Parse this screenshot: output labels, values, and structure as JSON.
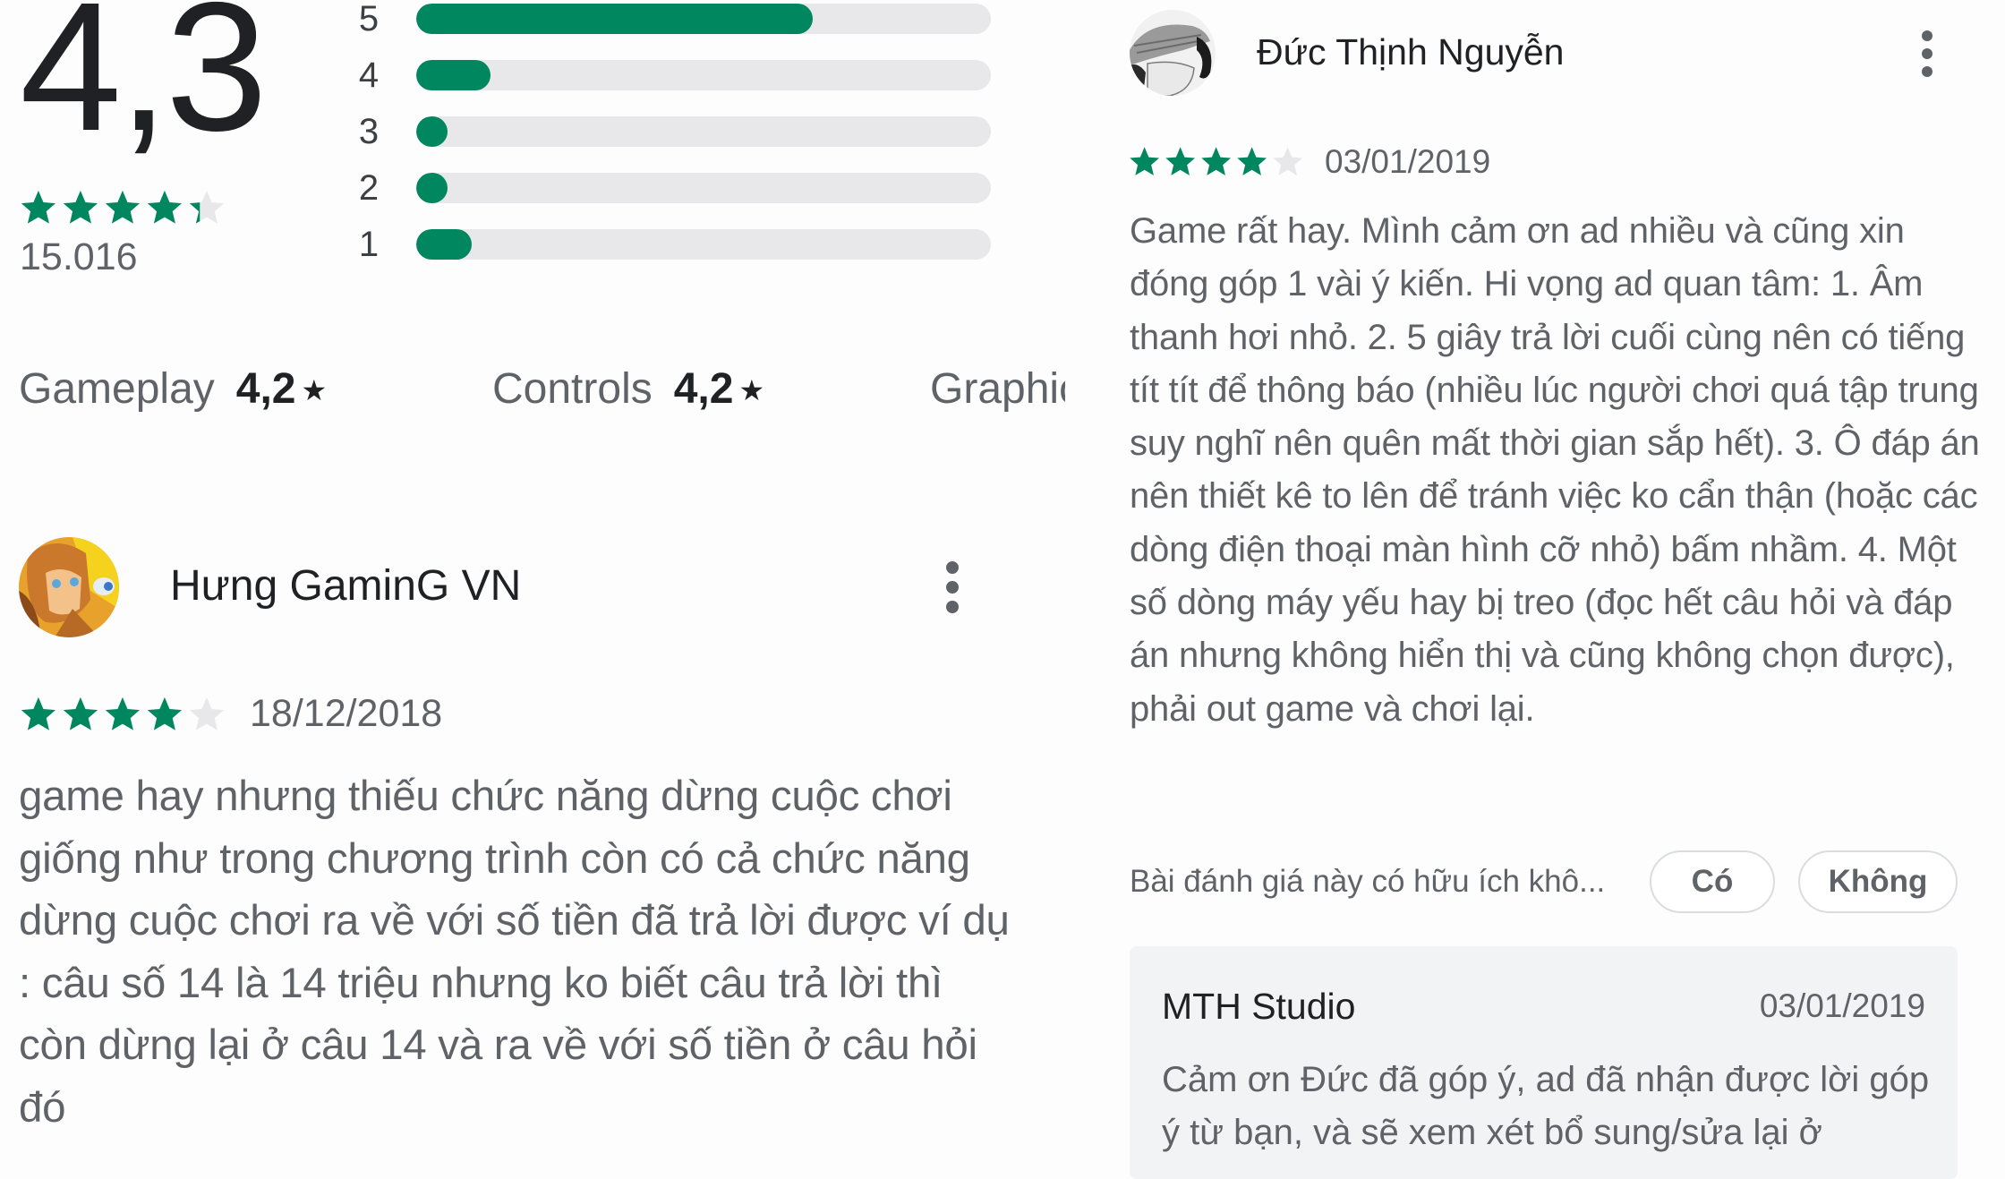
{
  "summary": {
    "average_rating": "4,3",
    "average_stars": 4.3,
    "rating_count": "15.016",
    "histogram": [
      {
        "label": "5",
        "fraction": 0.69
      },
      {
        "label": "4",
        "fraction": 0.13
      },
      {
        "label": "3",
        "fraction": 0.055
      },
      {
        "label": "2",
        "fraction": 0.054
      },
      {
        "label": "1",
        "fraction": 0.097
      }
    ]
  },
  "categories": [
    {
      "label": "Gameplay",
      "value": "4,2",
      "star": "★"
    },
    {
      "label": "Controls",
      "value": "4,2",
      "star": "★"
    },
    {
      "label": "Graphics",
      "value": "",
      "star": ""
    }
  ],
  "reviews": [
    {
      "author": "Hưng GaminG VN",
      "stars": 4,
      "date": "18/12/2018",
      "text": "game hay nhưng thiếu chức năng dừng cuộc chơi giống như trong chương trình còn có cả chức năng dừng cuộc chơi ra về với số tiền đã trả lời được ví dụ : câu số 14 là 14 triệu nhưng ko biết câu trả lời thì còn dừng lại ở câu 14 và ra về với số tiền ở câu hỏi đó",
      "avatar_icon": "game-character-avatar"
    },
    {
      "author": "Đức Thịnh Nguyễn",
      "stars": 4,
      "date": "03/01/2019",
      "text": "Game rất hay. Mình cảm ơn ad nhiều và cũng xin đóng góp 1 vài ý kiến. Hi vọng ad quan tâm: 1. Âm thanh hơi nhỏ. 2. 5 giây trả lời cuối cùng nên có tiếng tít tít để thông báo (nhiều lúc người chơi quá tập trung suy nghĩ nên quên mất thời gian sắp hết). 3. Ô đáp án nên thiết kê to lên để tránh việc ko cẩn thận (hoặc các dòng điện thoại màn hình cỡ nhỏ) bấm nhầm. 4. Một số dòng máy yếu hay bị treo (đọc hết câu hỏi và đáp án nhưng không hiển thị và cũng không chọn được), phải out game và chơi lại.",
      "avatar_icon": "sketch-portrait-avatar",
      "helpful_question": "Bài đánh giá này có hữu ích khô...",
      "helpful_yes": "Có",
      "helpful_no": "Không",
      "developer_reply": {
        "author": "MTH Studio",
        "date": "03/01/2019",
        "text": "Cảm ơn Đức đã góp ý, ad đã nhận được lời góp ý từ bạn, và sẽ xem xét bổ sung/sửa lại ở"
      }
    }
  ],
  "colors": {
    "star_filled": "#01875f",
    "star_empty": "#e8e8ea",
    "bar_fill": "#01875f",
    "bar_track": "#e8e8ea"
  }
}
